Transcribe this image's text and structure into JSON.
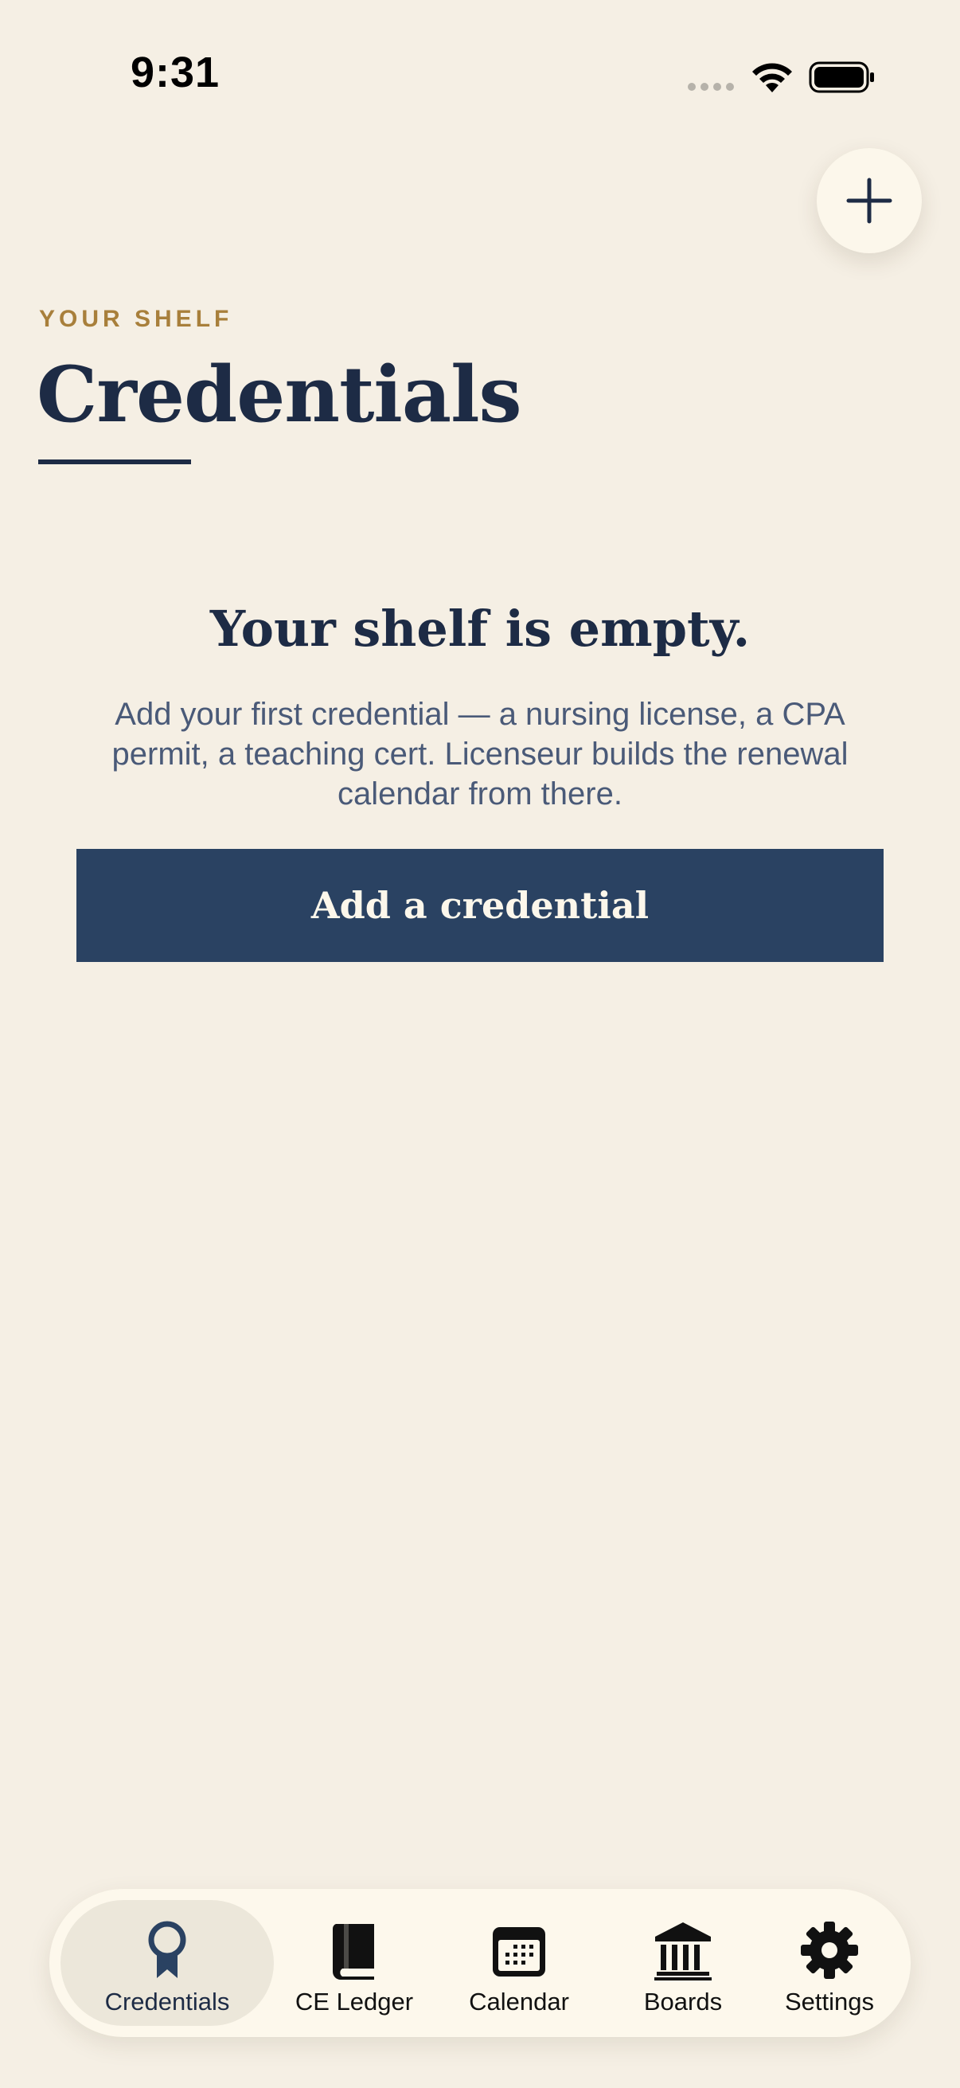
{
  "status_bar": {
    "time": "9:31",
    "icons": [
      "cellular-signal-icon",
      "wifi-icon",
      "battery-icon"
    ]
  },
  "header": {
    "eyebrow": "YOUR SHELF",
    "title": "Credentials",
    "add_button_icon": "plus-icon"
  },
  "empty_state": {
    "heading": "Your shelf is empty.",
    "body": "Add your first credential — a nursing license, a CPA permit, a teaching cert. Licenseur builds the renewal calendar from there.",
    "cta_label": "Add a credential"
  },
  "tab_bar": {
    "active": "Credentials",
    "tabs": [
      {
        "label": "Credentials",
        "icon": "award-ribbon-icon"
      },
      {
        "label": "CE Ledger",
        "icon": "book-icon"
      },
      {
        "label": "Calendar",
        "icon": "calendar-icon"
      },
      {
        "label": "Boards",
        "icon": "building-columns-icon"
      },
      {
        "label": "Settings",
        "icon": "gear-icon"
      }
    ]
  },
  "colors": {
    "background": "#F5EFE4",
    "navy": "#1D2B45",
    "button": "#2A4262",
    "accent_gold": "#A87F3B",
    "card": "#FDF8EC",
    "active_tab": "#ECE7DA"
  }
}
